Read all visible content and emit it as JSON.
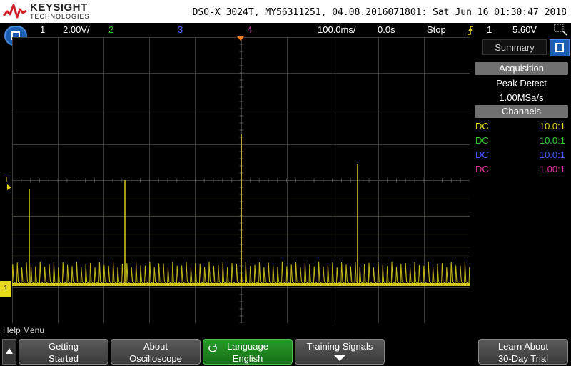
{
  "header": {
    "logo_line1": "KEYSIGHT",
    "logo_line2": "TECHNOLOGIES",
    "instrument_info": "DSO-X 3024T, MY56311251, 04.08.2016071801: Sat Jun 16 01:30:47 2018"
  },
  "status": {
    "ch1_label": "1",
    "ch1_scale": "2.00V/",
    "ch2_label": "2",
    "ch3_label": "3",
    "ch4_label": "4",
    "time_scale": "100.0ms/",
    "time_delay": "0.0s",
    "run_state": "Stop",
    "trigger_source": "1",
    "trigger_level": "5.60V"
  },
  "markers": {
    "trigger_level_label": "T",
    "ch1_ground_label": "1"
  },
  "panel": {
    "tab_label": "Summary",
    "acquisition_header": "Acquisition",
    "acq_mode": "Peak Detect",
    "sample_rate": "1.00MSa/s",
    "channels_header": "Channels",
    "channels": [
      {
        "coupling": "DC",
        "probe": "10.0:1",
        "color": "#e8d820"
      },
      {
        "coupling": "DC",
        "probe": "10.0:1",
        "color": "#30d030"
      },
      {
        "coupling": "DC",
        "probe": "10.0:1",
        "color": "#4060ff"
      },
      {
        "coupling": "DC",
        "probe": "1.00:1",
        "color": "#e030a0"
      }
    ]
  },
  "help": {
    "menu_title": "Help Menu",
    "softkeys": [
      {
        "line1": "Getting",
        "line2": "Started"
      },
      {
        "line1": "About",
        "line2": "Oscilloscope"
      },
      {
        "line1": "Language",
        "line2": "English"
      },
      {
        "line1": "Training Signals",
        "line2": ""
      },
      {
        "line1": "Learn About",
        "line2": "30-Day Trial"
      }
    ]
  },
  "colors": {
    "ch1": "#e8d820",
    "ch2": "#30d030",
    "ch3": "#4060ff",
    "ch4": "#e030a0",
    "trigger_marker": "#f08020",
    "accent_blue": "#1a5fb4"
  }
}
